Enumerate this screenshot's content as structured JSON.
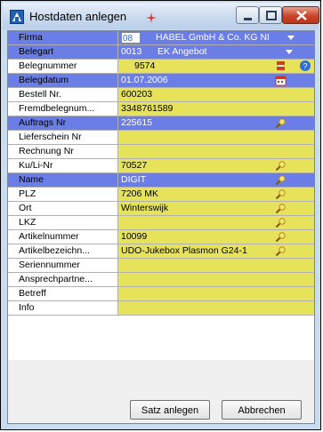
{
  "window": {
    "title": "Hostdaten anlegen"
  },
  "buttons": {
    "ok": "Satz anlegen",
    "cancel": "Abbrechen"
  },
  "rows": [
    {
      "label": "Firma",
      "code": "08",
      "value": "HABEL GmbH & Co. KG NI"
    },
    {
      "label": "Belegart",
      "code": "0013",
      "value": "EK Angebot"
    },
    {
      "label": "Belegnummer",
      "value": "9574"
    },
    {
      "label": "Belegdatum",
      "value": "01.07.2006"
    },
    {
      "label": "Bestell Nr.",
      "value": "600203"
    },
    {
      "label": "Fremdbelegnum...",
      "value": "3348761589"
    },
    {
      "label": "Auftrags Nr",
      "value": "225615"
    },
    {
      "label": "Lieferschein Nr",
      "value": ""
    },
    {
      "label": "Rechnung Nr",
      "value": ""
    },
    {
      "label": "Ku/Li-Nr",
      "value": "70527"
    },
    {
      "label": "Name",
      "value": "DIGIT"
    },
    {
      "label": "PLZ",
      "value": "7206 MK"
    },
    {
      "label": "Ort",
      "value": "Winterswijk"
    },
    {
      "label": "LKZ",
      "value": ""
    },
    {
      "label": "Artikelnummer",
      "value": "10099"
    },
    {
      "label": "Artikelbezeichn...",
      "value": "UDO-Jukebox Plasmon G24-1"
    },
    {
      "label": "Seriennummer",
      "value": ""
    },
    {
      "label": "Ansprechpartne...",
      "value": ""
    },
    {
      "label": "Betreff",
      "value": ""
    },
    {
      "label": "Info",
      "value": ""
    }
  ],
  "colors": {
    "highlight": "#6b7ee8",
    "field": "#e6e35a"
  },
  "icons": {
    "row_buttons": [
      "lookup-icon"
    ],
    "date": "calendar-icon",
    "number": "counter-icon",
    "help": "help-icon"
  }
}
